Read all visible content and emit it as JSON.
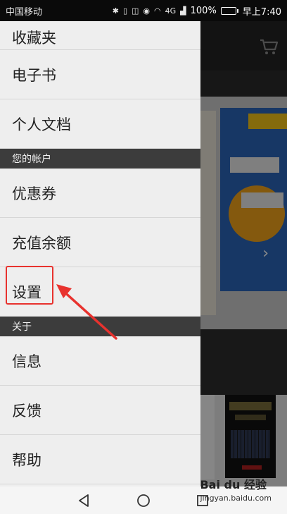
{
  "status_bar": {
    "carrier": "中国移动",
    "signal_label": "4G",
    "battery_text": "100%",
    "battery_level": 1.0,
    "time": "早上7:40"
  },
  "drawer": {
    "items_top": [
      {
        "label": "收藏夹"
      },
      {
        "label": "电子书"
      },
      {
        "label": "个人文档"
      }
    ],
    "section_account": "您的帐户",
    "items_account": [
      {
        "label": "优惠券"
      },
      {
        "label": "充值余额"
      },
      {
        "label": "设置"
      }
    ],
    "section_about": "关于",
    "items_about": [
      {
        "label": "信息"
      },
      {
        "label": "反馈"
      },
      {
        "label": "帮助"
      }
    ]
  },
  "background_app": {
    "icons": [
      "shopping-cart-icon",
      "chevron-right-icon"
    ]
  },
  "watermark": {
    "brand": "Bai du 经验",
    "url": "jingyan.baidu.com"
  },
  "colors": {
    "highlight": "#e8322e",
    "section_header_bg": "#3c3c3c",
    "drawer_bg": "#eeeeee"
  }
}
